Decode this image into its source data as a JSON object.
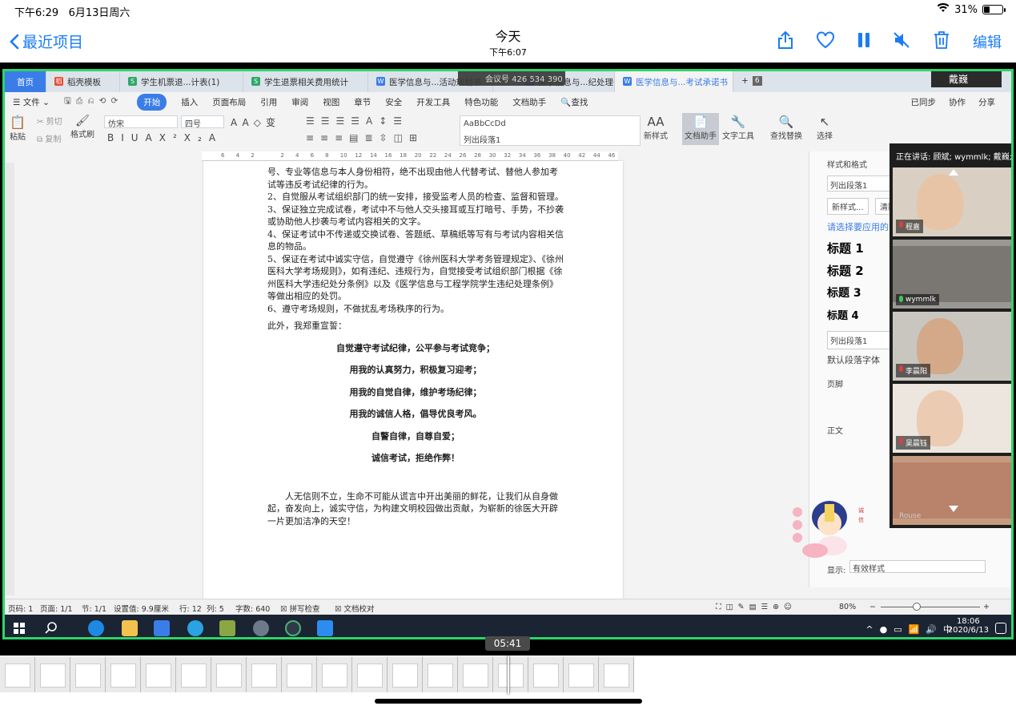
{
  "ios_status": {
    "time": "下午6:29",
    "date": "6月13日周六",
    "battery": "31%",
    "battery_level": 0.31
  },
  "nav": {
    "back": "最近项目",
    "title": "今天",
    "subtitle": "下午6:07",
    "edit": "编辑"
  },
  "wps": {
    "tabs": [
      {
        "label": "首页"
      },
      {
        "label": "稻壳模板"
      },
      {
        "label": "学生机票退...计表(1)"
      },
      {
        "label": "学生退票相关费用统计"
      },
      {
        "label": "医学信息与...活动规划书"
      },
      {
        "label": "医学信息与...纪处理条例"
      },
      {
        "label": "医学信息与...考试承诺书"
      }
    ],
    "tab_count": "6",
    "meeting_id": "会议号 426 534 390",
    "current_speaker": "戴巍",
    "menu": [
      "文件",
      "开始",
      "插入",
      "页面布局",
      "引用",
      "审阅",
      "视图",
      "章节",
      "安全",
      "开发工具",
      "特色功能",
      "文档助手",
      "查找"
    ],
    "menu_right": [
      "已同步",
      "协作",
      "分享"
    ],
    "tools": {
      "paste": "粘贴",
      "cut": "剪切",
      "copy": "复制",
      "format_painter": "格式刷",
      "font_name": "仿宋",
      "font_size": "四号",
      "style_preview": "AaBbCcDd",
      "style_name": "列出段落1",
      "new_style": "新样式",
      "doc_helper": "文档助手",
      "text_tools": "文字工具",
      "find_replace": "查找替换",
      "select": "选择"
    },
    "ruler_ticks": [
      "6",
      "4",
      "2",
      "",
      "2",
      "4",
      "6",
      "8",
      "10",
      "12",
      "14",
      "16",
      "18",
      "20",
      "22",
      "24",
      "26",
      "28",
      "30",
      "32",
      "34",
      "36",
      "38",
      "40",
      "42",
      "44",
      "46"
    ],
    "document": {
      "lines": [
        "号、专业等信息与本人身份相符，绝不出现由他人代替考试、替他人参加考试等违反考试纪律的行为。",
        "2、自觉服从考试组织部门的统一安排，接受监考人员的检查、监督和管理。",
        "3、保证独立完成试卷，考试中不与他人交头接耳或互打暗号、手势，不抄袭或协助他人抄袭与考试内容相关的文字。",
        "4、保证考试中不传递或交换试卷、答题纸、草稿纸等写有与考试内容相关信息的物品。",
        "5、保证在考试中诚实守信，自觉遵守《徐州医科大学考务管理规定》、《徐州医科大学考场规则》，如有违纪、违规行为，自觉接受考试组织部门根据《徐州医科大学违纪处分条例》以及《医学信息与工程学院学生违纪处理条例》等做出相应的处罚。",
        "6、遵守考场规则，不做扰乱考场秩序的行为。"
      ],
      "intro": "此外，我郑重宣誓：",
      "oath": [
        "自觉遵守考试纪律，公平参与考试竞争；",
        "用我的认真努力，积极复习迎考；",
        "用我的自觉自律，维护考场纪律；",
        "用我的诚信人格，倡导优良考风。",
        "自警自律，自尊自爱；",
        "诚信考试，拒绝作弊！"
      ],
      "closing": "人无信则不立，生命不可能从谎言中开出美丽的鲜花，让我们从自身做起，奋发向上，诚实守信，为构建文明校园做出贡献，为崭新的徐医大开辟一片更加洁净的天空！"
    },
    "style_panel": {
      "title": "样式和格式",
      "current": "列出段落1",
      "new_style": "新样式...",
      "clear": "清除",
      "prompt": "请选择要应用的",
      "headings": [
        "标题 1",
        "标题 2",
        "标题 3",
        "标题 4"
      ],
      "items": [
        "列出段落1",
        "默认段落字体",
        "页脚",
        "正文"
      ],
      "show_label": "显示:",
      "show_value": "有效样式"
    },
    "video_panel": {
      "speaking": "正在讲话: 顾斌; wymmlk; 戴巍;",
      "participants": [
        {
          "name": "程嘉",
          "mic": "#d94040"
        },
        {
          "name": "wymmlk",
          "mic": "#3cc85a"
        },
        {
          "name": "李晨阳",
          "mic": "#d94040"
        },
        {
          "name": "吴晨钰",
          "mic": "#d94040"
        },
        {
          "name": "Rouse",
          "mic": ""
        }
      ]
    },
    "statusbar": {
      "page_num": "页码: 1",
      "pages": "页面: 1/1",
      "section": "节: 1/1",
      "setting": "设置值: 9.9厘米",
      "row": "行: 12",
      "col": "列: 5",
      "word_count": "字数: 640",
      "spell": "拼写检查",
      "proof": "文档校对",
      "zoom": "80%"
    },
    "taskbar": {
      "ime": "中",
      "time": "18:06",
      "date": "2020/6/13"
    }
  },
  "player": {
    "timecode": "05:41"
  },
  "colors": {
    "ios_blue": "#1a7cf5",
    "wps_blue": "#3b7de8",
    "frame_green": "#2fd36b"
  }
}
